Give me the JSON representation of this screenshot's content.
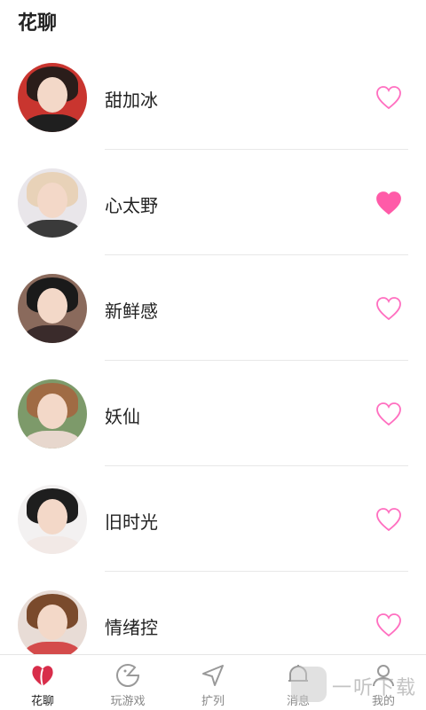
{
  "header": {
    "title": "花聊"
  },
  "list": {
    "items": [
      {
        "name": "甜加冰",
        "liked": false,
        "hair": "#2a1d1a",
        "body": "#1f1f1f",
        "bg": "#c9352f"
      },
      {
        "name": "心太野",
        "liked": true,
        "hair": "#e8d2b8",
        "body": "#3a3a3a",
        "bg": "#e9e6ea"
      },
      {
        "name": "新鲜感",
        "liked": false,
        "hair": "#1a1a1a",
        "body": "#3a2b2b",
        "bg": "#8a6a5c"
      },
      {
        "name": "妖仙",
        "liked": false,
        "hair": "#a06b44",
        "body": "#e7d7cd",
        "bg": "#7d9a6a"
      },
      {
        "name": "旧时光",
        "liked": false,
        "hair": "#1e1e1e",
        "body": "#f2e9e6",
        "bg": "#f3f1f1"
      },
      {
        "name": "情绪控",
        "liked": false,
        "hair": "#7a4a2c",
        "body": "#d44b4b",
        "bg": "#e8dcd6"
      }
    ]
  },
  "tabbar": {
    "tabs": [
      {
        "label": "花聊",
        "icon": "flower-chat-icon",
        "active": true
      },
      {
        "label": "玩游戏",
        "icon": "game-icon",
        "active": false
      },
      {
        "label": "扩列",
        "icon": "send-arrow-icon",
        "active": false
      },
      {
        "label": "消息",
        "icon": "message-icon",
        "active": false
      },
      {
        "label": "我的",
        "icon": "profile-icon",
        "active": false
      }
    ]
  },
  "watermark": {
    "text": "一听下载"
  },
  "colors": {
    "accent": "#ff5ba8",
    "heart_outline": "#ff6fc0",
    "active_tab": "#d82d4a"
  }
}
